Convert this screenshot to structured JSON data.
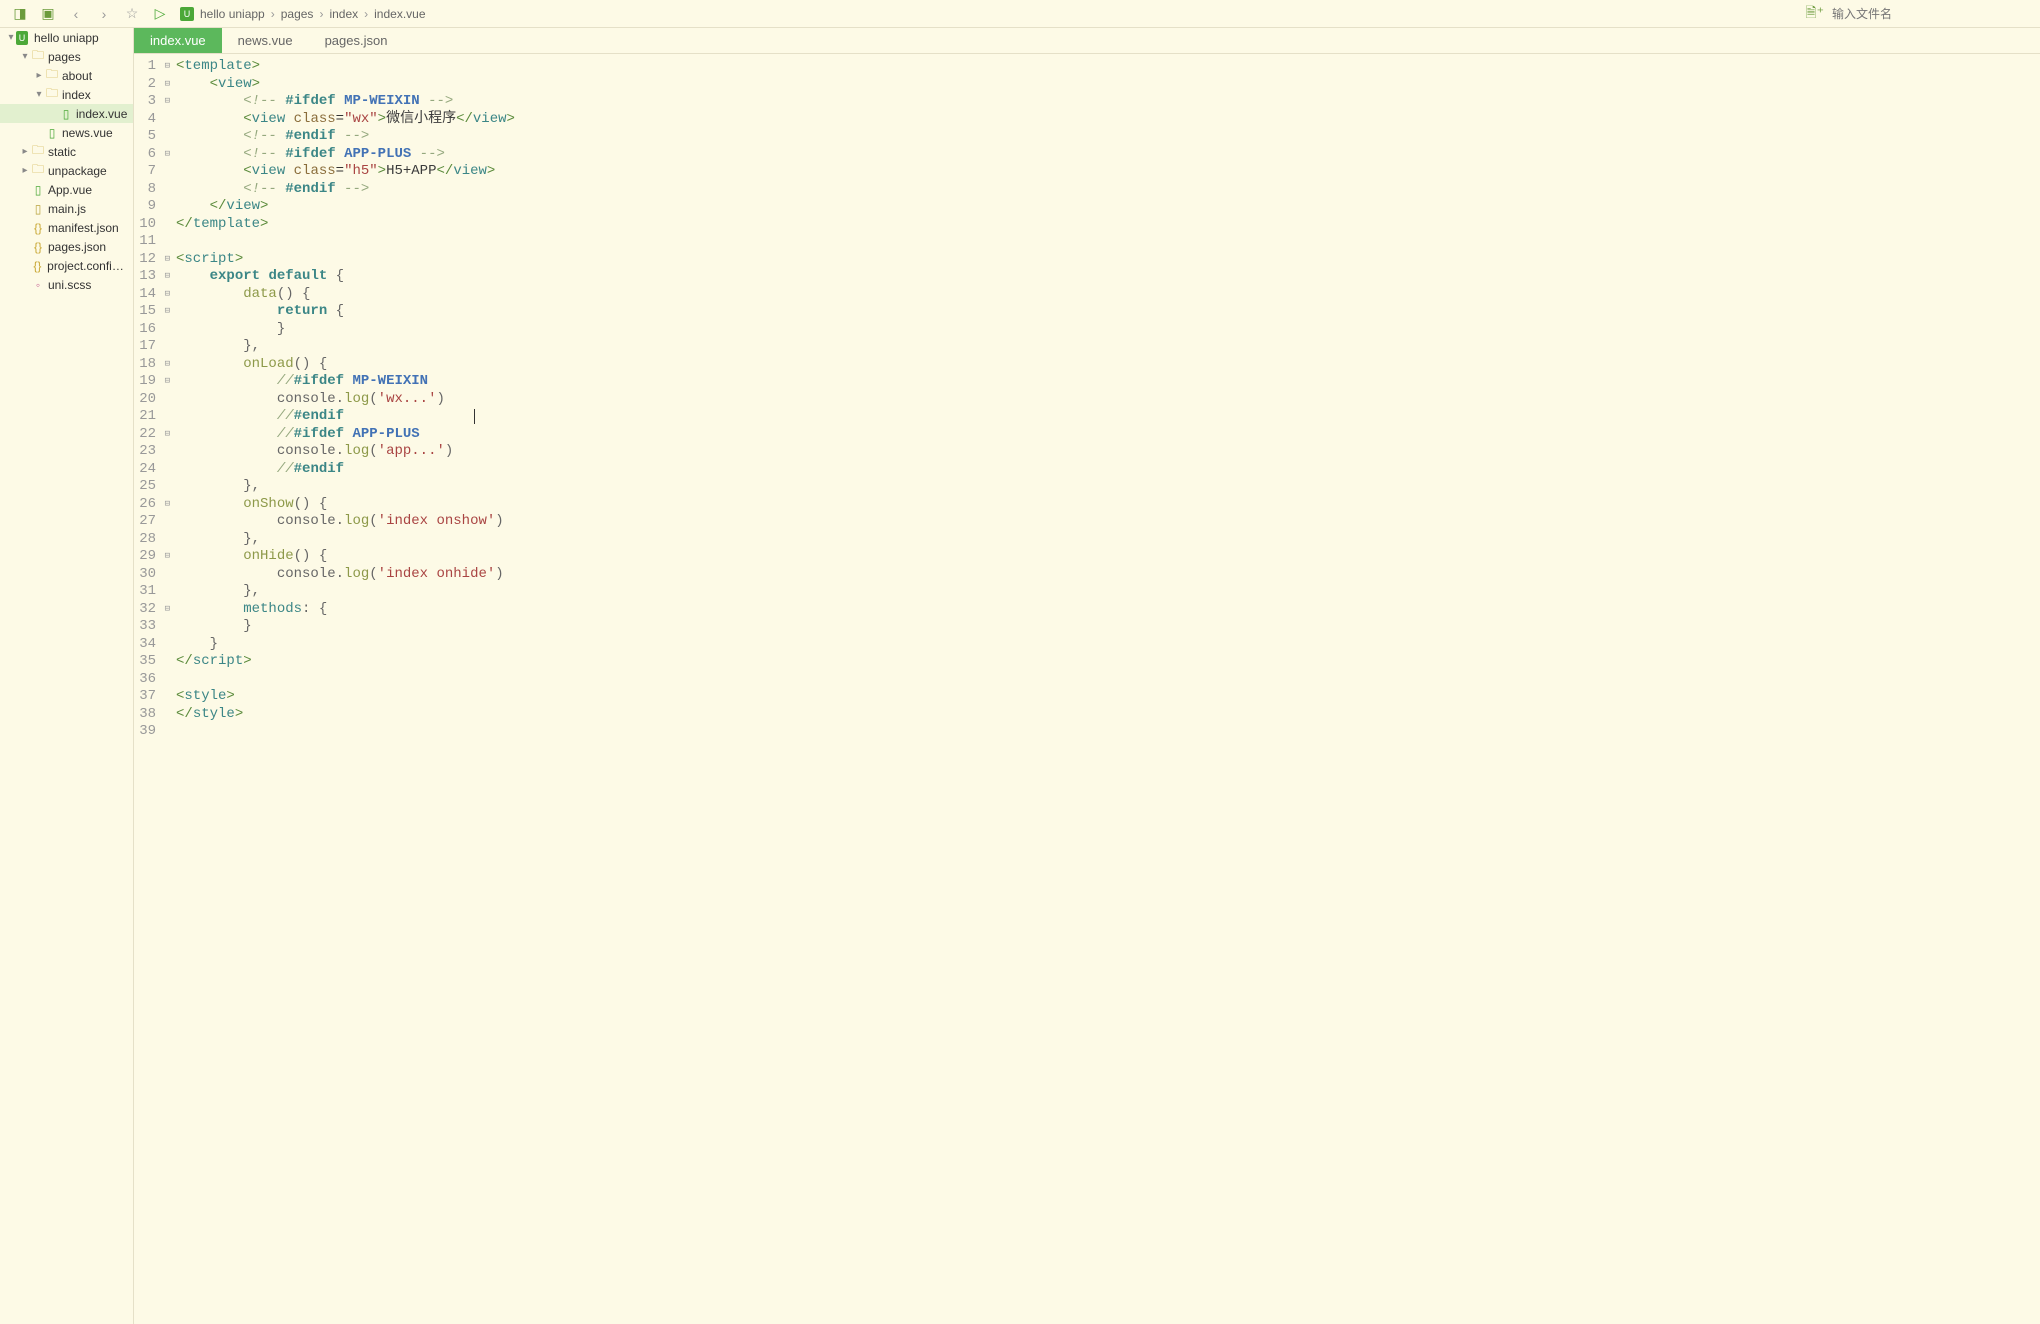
{
  "toolbar": {
    "search_placeholder": "输入文件名"
  },
  "breadcrumb": {
    "items": [
      "hello uniapp",
      "pages",
      "index",
      "index.vue"
    ]
  },
  "sidebar": {
    "tree": [
      {
        "level": 0,
        "expanded": true,
        "icon": "u-badge",
        "label": "hello uniapp"
      },
      {
        "level": 1,
        "expanded": true,
        "icon": "folder",
        "label": "pages"
      },
      {
        "level": 2,
        "expanded": false,
        "icon": "folder",
        "label": "about"
      },
      {
        "level": 2,
        "expanded": true,
        "icon": "folder",
        "label": "index"
      },
      {
        "level": 3,
        "icon": "vue",
        "label": "index.vue",
        "selected": true
      },
      {
        "level": 2,
        "icon": "vue",
        "label": "news.vue"
      },
      {
        "level": 1,
        "expanded": false,
        "icon": "folder",
        "label": "static"
      },
      {
        "level": 1,
        "expanded": false,
        "icon": "folder",
        "label": "unpackage"
      },
      {
        "level": 1,
        "icon": "vue",
        "label": "App.vue"
      },
      {
        "level": 1,
        "icon": "js",
        "label": "main.js"
      },
      {
        "level": 1,
        "icon": "json",
        "label": "manifest.json"
      },
      {
        "level": 1,
        "icon": "json",
        "label": "pages.json"
      },
      {
        "level": 1,
        "icon": "json",
        "label": "project.config...."
      },
      {
        "level": 1,
        "icon": "scss",
        "label": "uni.scss"
      }
    ]
  },
  "tabs": [
    {
      "label": "index.vue",
      "active": true
    },
    {
      "label": "news.vue"
    },
    {
      "label": "pages.json"
    }
  ],
  "code": {
    "lines": [
      {
        "num": 1,
        "fold": true,
        "html": "<span class='tag-bracket'>&lt;</span><span class='tag-name'>template</span><span class='tag-bracket'>&gt;</span>"
      },
      {
        "num": 2,
        "fold": true,
        "html": "    <span class='tag-bracket'>&lt;</span><span class='tag-name'>view</span><span class='tag-bracket'>&gt;</span>"
      },
      {
        "num": 3,
        "fold": true,
        "html": "        <span class='comment'>&lt;!-- </span><span class='directive'>#ifdef</span> <span class='directive-val'>MP-WEIXIN</span><span class='comment'> --&gt;</span>"
      },
      {
        "num": 4,
        "html": "        <span class='tag-bracket'>&lt;</span><span class='tag-name'>view</span> <span class='attr-name'>class</span>=<span class='attr-val'>\"wx\"</span><span class='tag-bracket'>&gt;</span><span class='text-content'>微信小程序</span><span class='tag-bracket'>&lt;/</span><span class='tag-name'>view</span><span class='tag-bracket'>&gt;</span>"
      },
      {
        "num": 5,
        "html": "        <span class='comment'>&lt;!-- </span><span class='directive'>#endif</span><span class='comment'> --&gt;</span>"
      },
      {
        "num": 6,
        "fold": true,
        "html": "        <span class='comment'>&lt;!-- </span><span class='directive'>#ifdef</span> <span class='directive-val'>APP-PLUS</span><span class='comment'> --&gt;</span>"
      },
      {
        "num": 7,
        "html": "        <span class='tag-bracket'>&lt;</span><span class='tag-name'>view</span> <span class='attr-name'>class</span>=<span class='attr-val'>\"h5\"</span><span class='tag-bracket'>&gt;</span><span class='text-content'>H5+APP</span><span class='tag-bracket'>&lt;/</span><span class='tag-name'>view</span><span class='tag-bracket'>&gt;</span>"
      },
      {
        "num": 8,
        "html": "        <span class='comment'>&lt;!-- </span><span class='directive'>#endif</span><span class='comment'> --&gt;</span>"
      },
      {
        "num": 9,
        "html": "    <span class='tag-bracket'>&lt;/</span><span class='tag-name'>view</span><span class='tag-bracket'>&gt;</span>"
      },
      {
        "num": 10,
        "html": "<span class='tag-bracket'>&lt;/</span><span class='tag-name'>template</span><span class='tag-bracket'>&gt;</span>"
      },
      {
        "num": 11,
        "html": ""
      },
      {
        "num": 12,
        "fold": true,
        "html": "<span class='tag-bracket'>&lt;</span><span class='tag-name'>script</span><span class='tag-bracket'>&gt;</span>"
      },
      {
        "num": 13,
        "fold": true,
        "html": "    <span class='keyword'>export</span> <span class='keyword'>default</span> <span class='plain'>{</span>"
      },
      {
        "num": 14,
        "fold": true,
        "html": "        <span class='method'>data</span><span class='plain'>() {</span>"
      },
      {
        "num": 15,
        "fold": true,
        "html": "            <span class='keyword'>return</span> <span class='plain'>{</span>"
      },
      {
        "num": 16,
        "html": "            <span class='plain'>}</span>"
      },
      {
        "num": 17,
        "html": "        <span class='plain'>},</span>"
      },
      {
        "num": 18,
        "fold": true,
        "html": "        <span class='method'>onLoad</span><span class='plain'>() {</span>"
      },
      {
        "num": 19,
        "fold": true,
        "html": "            <span class='comment'>//</span><span class='directive'>#ifdef</span> <span class='directive-val'>MP-WEIXIN</span>"
      },
      {
        "num": 20,
        "html": "            <span class='plain'>console.</span><span class='funcname'>log</span><span class='plain'>(</span><span class='string'>'wx...'</span><span class='plain'>)</span>"
      },
      {
        "num": 21,
        "html": "            <span class='comment'>//</span><span class='directive'>#endif</span><span class='cursor'></span>"
      },
      {
        "num": 22,
        "fold": true,
        "html": "            <span class='comment'>//</span><span class='directive'>#ifdef</span> <span class='directive-val'>APP-PLUS</span>"
      },
      {
        "num": 23,
        "html": "            <span class='plain'>console.</span><span class='funcname'>log</span><span class='plain'>(</span><span class='string'>'app...'</span><span class='plain'>)</span>"
      },
      {
        "num": 24,
        "html": "            <span class='comment'>//</span><span class='directive'>#endif</span>"
      },
      {
        "num": 25,
        "html": "        <span class='plain'>},</span>"
      },
      {
        "num": 26,
        "fold": true,
        "html": "        <span class='method'>onShow</span><span class='plain'>() {</span>"
      },
      {
        "num": 27,
        "html": "            <span class='plain'>console.</span><span class='funcname'>log</span><span class='plain'>(</span><span class='string'>'index onshow'</span><span class='plain'>)</span>"
      },
      {
        "num": 28,
        "html": "        <span class='plain'>},</span>"
      },
      {
        "num": 29,
        "fold": true,
        "html": "        <span class='method'>onHide</span><span class='plain'>() {</span>"
      },
      {
        "num": 30,
        "html": "            <span class='plain'>console.</span><span class='funcname'>log</span><span class='plain'>(</span><span class='string'>'index onhide'</span><span class='plain'>)</span>"
      },
      {
        "num": 31,
        "html": "        <span class='plain'>},</span>"
      },
      {
        "num": 32,
        "fold": true,
        "html": "        <span class='keyword2'>methods</span><span class='plain'>: {</span>"
      },
      {
        "num": 33,
        "html": "        <span class='plain'>}</span>"
      },
      {
        "num": 34,
        "html": "    <span class='plain'>}</span>"
      },
      {
        "num": 35,
        "html": "<span class='tag-bracket'>&lt;/</span><span class='tag-name'>script</span><span class='tag-bracket'>&gt;</span>"
      },
      {
        "num": 36,
        "html": ""
      },
      {
        "num": 37,
        "html": "<span class='tag-bracket'>&lt;</span><span class='tag-name'>style</span><span class='tag-bracket'>&gt;</span>"
      },
      {
        "num": 38,
        "html": "<span class='tag-bracket'>&lt;/</span><span class='tag-name'>style</span><span class='tag-bracket'>&gt;</span>"
      },
      {
        "num": 39,
        "html": ""
      }
    ]
  }
}
